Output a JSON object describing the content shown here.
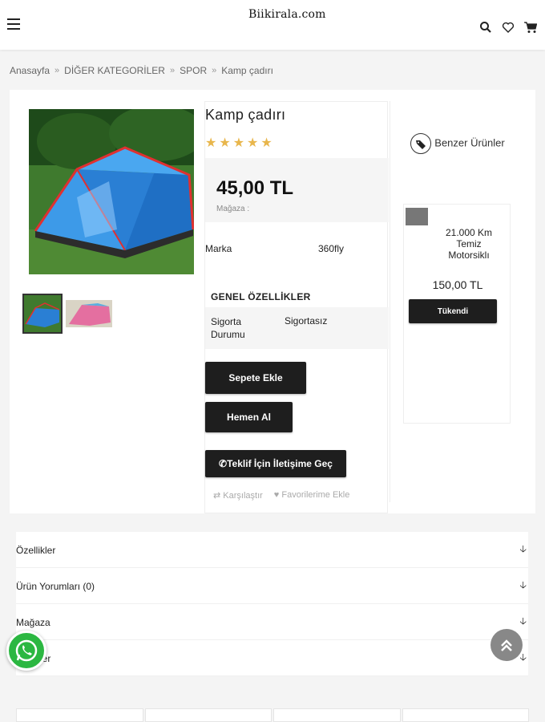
{
  "header": {
    "logo": "Biikirala.com",
    "icons": [
      "menu-icon",
      "search-icon",
      "heart-icon",
      "cart-icon"
    ]
  },
  "breadcrumb": [
    "Anasayfa",
    "DİĞER KATEGORİLER",
    "SPOR",
    "Kamp çadırı"
  ],
  "breadcrumb_separator": "»",
  "product": {
    "title": "Kamp çadırı",
    "rating_stars": 5,
    "price": "45,00 TL",
    "store_label": "Mağaza :",
    "brand_label": "Marka",
    "brand_value": "360fly",
    "general_heading": "GENEL ÖZELLİKLER",
    "spec_label": "Sigorta Durumu",
    "spec_value": "Sigortasız",
    "add_to_cart": "Sepete Ekle",
    "buy_now": "Hemen Al",
    "offer_contact": "Teklif İçin İletişime Geç",
    "compare": "Karşılaştır",
    "add_favorites": "Favorilerime Ekle"
  },
  "similar": {
    "heading": "Benzer Ürünler",
    "item_name": "21.000 Km Temiz Motorsiklı",
    "item_price": "150,00 TL",
    "item_button": "Tükendi"
  },
  "accordion": [
    {
      "label": "Özellikler"
    },
    {
      "label": "Ürün Yorumları (0)"
    },
    {
      "label": "Mağaza"
    },
    {
      "label": "Etiketler"
    }
  ],
  "colors": {
    "button_bg": "#1e1e1e",
    "star": "#e8b64c",
    "whatsapp": "#2bb741"
  }
}
